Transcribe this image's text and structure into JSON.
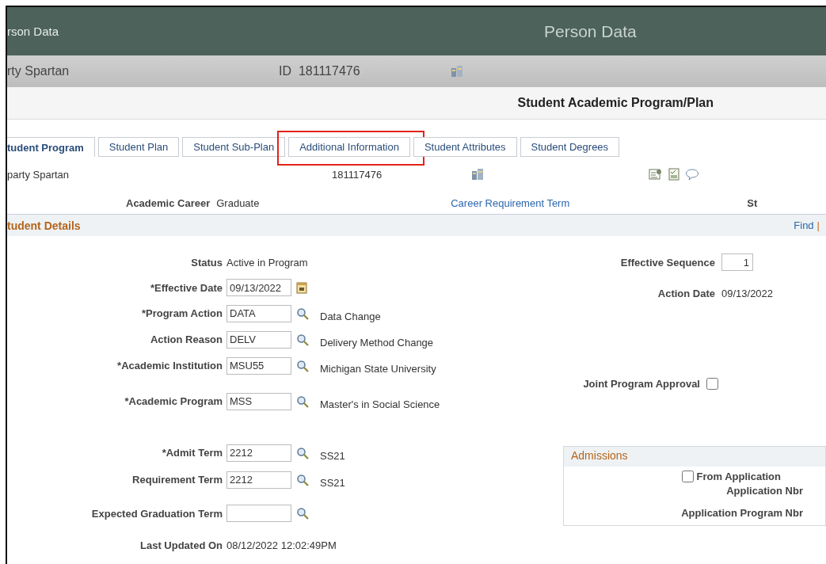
{
  "header": {
    "left_title": "rson Data",
    "title": "Person Data"
  },
  "person_bar": {
    "name": "rty Spartan",
    "id_label": "ID",
    "id": "181117476"
  },
  "page_title": "Student Academic Program/Plan",
  "tabs": [
    {
      "label": "tudent Program",
      "selected": true,
      "highlighted": false
    },
    {
      "label": "Student Plan",
      "selected": false,
      "highlighted": false
    },
    {
      "label": "Student Sub-Plan",
      "selected": false,
      "highlighted": false
    },
    {
      "label": "Additional Information",
      "selected": false,
      "highlighted": true
    },
    {
      "label": "Student Attributes",
      "selected": false,
      "highlighted": false
    },
    {
      "label": "Student Degrees",
      "selected": false,
      "highlighted": false
    }
  ],
  "summary": {
    "name": "party Spartan",
    "id": "181117476"
  },
  "career": {
    "label": "Academic Career",
    "value": "Graduate",
    "link": "Career Requirement Term",
    "cut_label": "St"
  },
  "section": {
    "title": "tudent Details",
    "link": "Find",
    "separator": "|"
  },
  "left_fields": [
    {
      "kind": "text",
      "label": "Status",
      "value": "Active in Program"
    },
    {
      "kind": "date",
      "label": "*Effective Date",
      "value": "09/13/2022"
    },
    {
      "kind": "lookup",
      "label": "*Program Action",
      "value": "DATA",
      "description": "Data Change"
    },
    {
      "kind": "lookup",
      "label": "Action Reason",
      "value": "DELV",
      "description": "Delivery Method Change"
    },
    {
      "kind": "lookup",
      "label": "*Academic Institution",
      "value": "MSU55",
      "description": "Michigan State University"
    },
    {
      "kind": "lookup",
      "label": "*Academic Program",
      "value": "MSS",
      "description": "Master's in Social Science"
    },
    {
      "kind": "lookup",
      "label": "*Admit Term",
      "value": "2212",
      "description": "SS21"
    },
    {
      "kind": "lookup",
      "label": "Requirement Term",
      "value": "2212",
      "description": "SS21"
    },
    {
      "kind": "lookup",
      "label": "Expected Graduation Term"
    },
    {
      "kind": "text",
      "label": "Last Updated On",
      "value": "08/12/2022 12:02:49PM"
    }
  ],
  "right_fields": [
    {
      "kind": "number",
      "label": "Effective Sequence",
      "value": "1"
    },
    {
      "kind": "text",
      "label": "Action Date",
      "value": "09/13/2022"
    },
    {
      "kind": "checkbox",
      "label": "Joint Program Approval",
      "checked": false
    }
  ],
  "admissions": {
    "title": "Admissions",
    "from_application": {
      "label": "From Application",
      "checked": false
    },
    "labels": [
      "Application Nbr",
      "Application Program Nbr"
    ]
  }
}
